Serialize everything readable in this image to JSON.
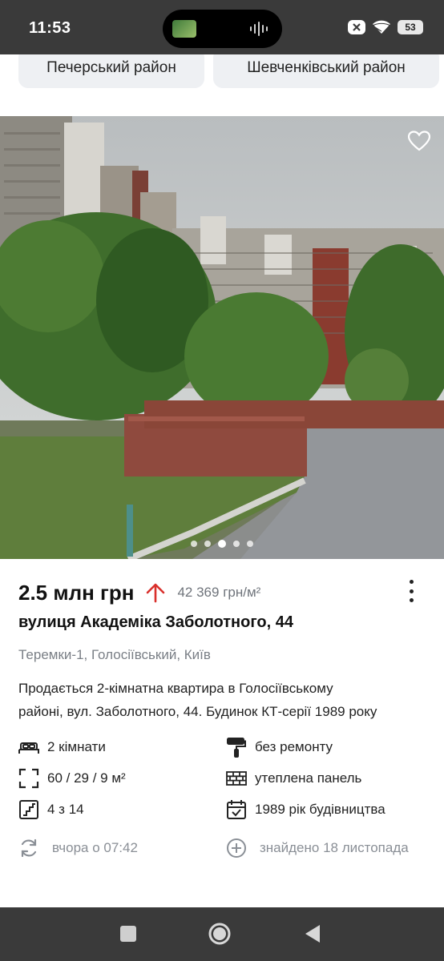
{
  "status_bar": {
    "time": "11:53",
    "battery": "53"
  },
  "districts": [
    "Печерський район",
    "Шевченківський район"
  ],
  "listing": {
    "price": "2.5 млн грн",
    "price_per_m2": "42 369 грн/м²",
    "address": "вулиця Академіка Заболотного, 44",
    "area": "Теремки-1, Голосіївський, Київ",
    "description_line1": "Продається 2-кімнатна квартира в Голосіївському",
    "description_line2": "районі, вул. Заболотного, 44. Будинок КТ-серії 1989 року",
    "features": {
      "rooms": "2 кімнати",
      "repair": "без ремонту",
      "size": "60 / 29 / 9 м²",
      "wall": "утеплена панель",
      "floor": "4 з 14",
      "year": "1989 рік будівництва"
    },
    "updated": "вчора о 07:42",
    "found": "знайдено 18 листопада"
  },
  "gallery": {
    "total_photos": 5,
    "active_index": 2
  },
  "icons": {
    "trend": "arrow-up-icon",
    "rooms": "bed-icon",
    "repair": "paint-roller-icon",
    "size": "area-frame-icon",
    "wall": "brick-wall-icon",
    "floor": "stairs-icon",
    "year": "calendar-check-icon",
    "updated": "refresh-icon",
    "found": "plus-circle-icon"
  },
  "colors": {
    "trend_up": "#d9302c",
    "status_bar": "#3a3a3a",
    "chip_bg": "#eef0f3",
    "muted_text": "#7a7f86"
  }
}
